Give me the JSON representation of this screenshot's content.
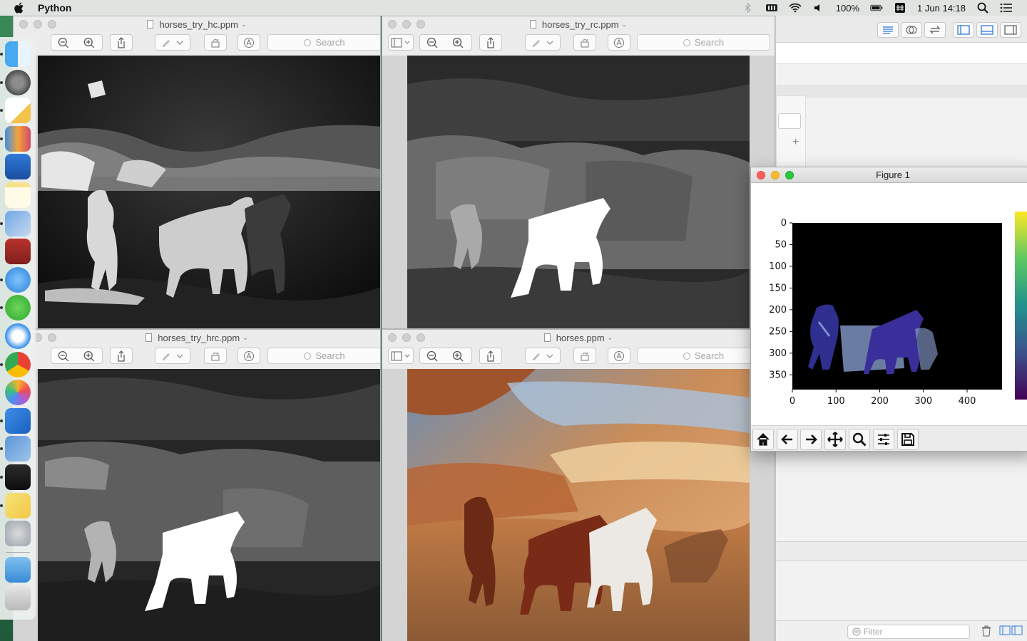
{
  "menubar": {
    "app_name": "Python",
    "battery": "100%",
    "date_time": "1 Jun  14:18",
    "icons": [
      "apple-icon",
      "bluetooth-icon",
      "memory-icon",
      "wifi-icon",
      "volume-icon",
      "battery-icon",
      "input-source-icon",
      "spotlight-icon",
      "notification-center-icon"
    ]
  },
  "dock": {
    "apps": [
      "finder",
      "system-preferences",
      "textedit",
      "keynote-charts",
      "keynote",
      "notes",
      "preview",
      "dictionary",
      "chat",
      "wechat",
      "safari",
      "chrome",
      "photos",
      "xcode",
      "preview-2",
      "terminal",
      "stickies",
      "launchpad",
      "downloads",
      "trash"
    ]
  },
  "windows": {
    "hc": {
      "title": "horses_try_hc.ppm",
      "search_placeholder": "Search"
    },
    "rc": {
      "title": "horses_try_rc.ppm",
      "search_placeholder": "Search"
    },
    "hrc": {
      "title": "horses_try_hrc.ppm",
      "search_placeholder": "Search"
    },
    "orig": {
      "title": "horses.ppm",
      "search_placeholder": "Search"
    }
  },
  "figure": {
    "title": "Figure 1",
    "y_ticks": [
      "0",
      "50",
      "100",
      "150",
      "200",
      "250",
      "300",
      "350"
    ],
    "x_ticks": [
      "0",
      "100",
      "200",
      "300",
      "400"
    ],
    "toolbar": [
      "home-icon",
      "back-icon",
      "forward-icon",
      "pan-icon",
      "zoom-icon",
      "configure-subplots-icon",
      "save-icon"
    ]
  },
  "xwin": {
    "filter_placeholder": "Filter"
  }
}
